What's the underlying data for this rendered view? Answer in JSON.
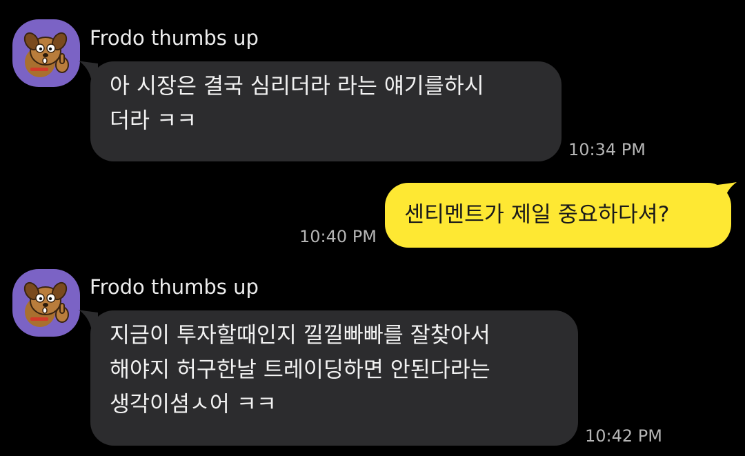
{
  "colors": {
    "background": "#000000",
    "incoming_bubble": "#2c2c2e",
    "outgoing_bubble": "#fee833",
    "avatar_bg": "#7b63c5",
    "timestamp": "#b5b5b5"
  },
  "messages": [
    {
      "direction": "incoming",
      "sender": "Frodo thumbs up",
      "avatar_icon": "frodo-dog-thumbs-up-icon",
      "lines": [
        "아 시장은 결국 심리더라 라는 얘기를하시",
        "더라 ㅋㅋ"
      ],
      "time": "10:34 PM"
    },
    {
      "direction": "outgoing",
      "lines": [
        "센티멘트가 제일 중요하다셔?"
      ],
      "time": "10:40 PM"
    },
    {
      "direction": "incoming",
      "sender": "Frodo thumbs up",
      "avatar_icon": "frodo-dog-thumbs-up-icon",
      "lines": [
        "지금이 투자할때인지 낄낄빠빠를 잘찾아서",
        "해야지 허구한날 트레이딩하면 안된다라는",
        "생각이셤ㅅ어 ㅋㅋ"
      ],
      "time": "10:42 PM"
    }
  ]
}
